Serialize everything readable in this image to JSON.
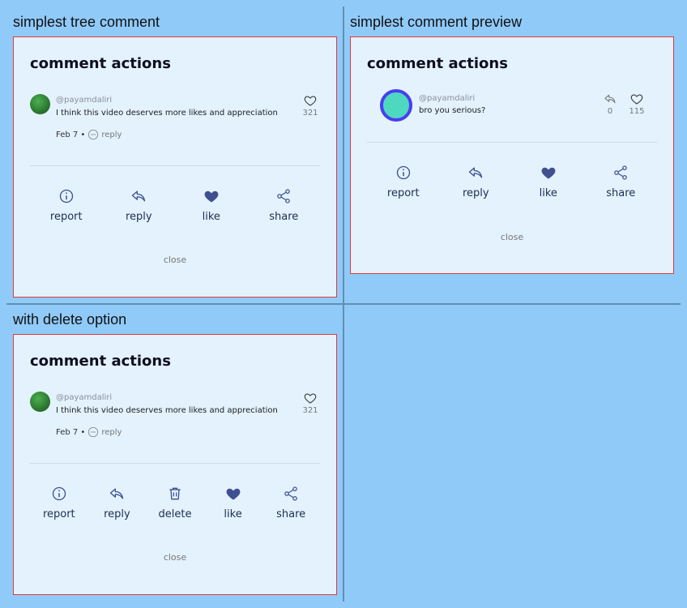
{
  "panels": {
    "tree": {
      "label": "simplest tree comment"
    },
    "preview": {
      "label": "simplest comment preview"
    },
    "delete": {
      "label": "with delete option"
    }
  },
  "card": {
    "title": "comment actions",
    "close_label": "close"
  },
  "tree_comment": {
    "username": "@payamdaliri",
    "text": "I think this video deserves more likes and appreciation",
    "date": "Feb 7 •",
    "reply_label": "reply",
    "likes": "321"
  },
  "preview_comment": {
    "username": "@payamdaliri",
    "text": "bro you serious?",
    "replies": "0",
    "likes": "115"
  },
  "actions": {
    "report": "report",
    "reply": "reply",
    "delete": "delete",
    "like": "like",
    "share": "share"
  },
  "colors": {
    "background": "#90caf9",
    "card": "#e3f2fd",
    "card_border": "#e53935",
    "icon": "#3f4f8f",
    "avatar_fill": "#4dd9c0",
    "avatar_ring": "#4a3df0"
  }
}
